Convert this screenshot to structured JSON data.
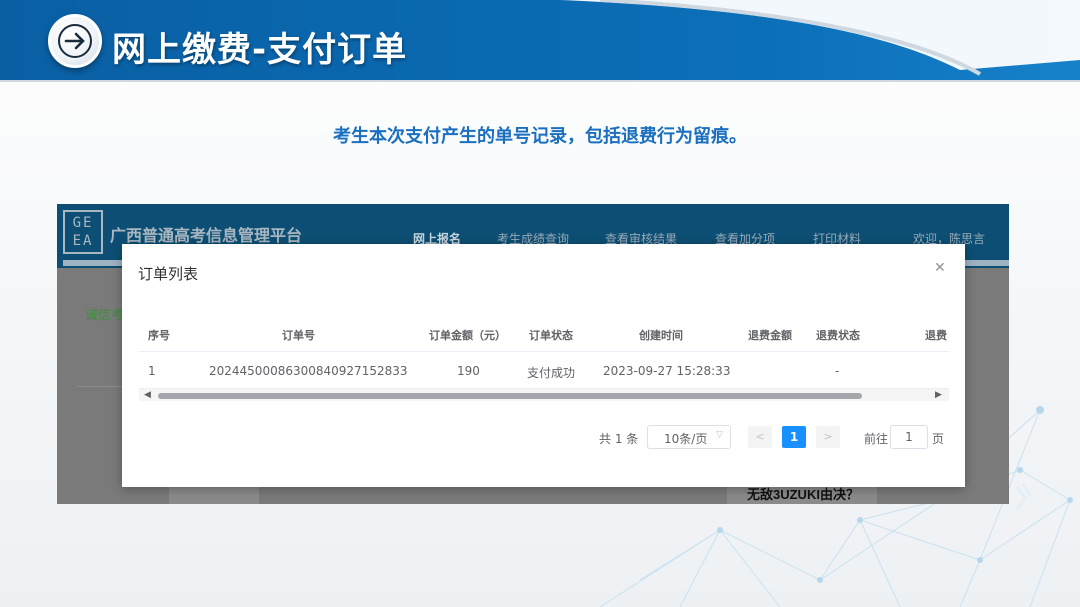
{
  "slide": {
    "title": "网上缴费-支付订单",
    "subtitle": "考生本次支付产生的单号记录，包括退费行为留痕。"
  },
  "app": {
    "logo_text": "GE EA",
    "name": "广西普通高考信息管理平台",
    "nav": [
      "网上报名",
      "考生成绩查询",
      "查看审核结果",
      "查看加分项",
      "打印材料"
    ],
    "welcome": "欢迎，陈思言",
    "left_text": "诚信考",
    "bottom_text": "无敌3UZUKI由决？"
  },
  "modal": {
    "title": "订单列表",
    "close_icon": "close-icon",
    "columns": [
      "序号",
      "订单号",
      "订单金额（元）",
      "订单状态",
      "创建时间",
      "退费金额",
      "退费状态",
      "退费"
    ],
    "rows": [
      {
        "index": "1",
        "order_no": "202445000863008409271528​33",
        "amount": "190",
        "status": "支付成功",
        "created": "2023-09-27 15:28:33",
        "refund_amount": "",
        "refund_status": "-"
      }
    ],
    "pager": {
      "total": "共 1 条",
      "page_size": "10条/页",
      "prev": "<",
      "current": "1",
      "next": ">",
      "goto_label": "前往",
      "goto_value": "1",
      "page_word": "页"
    }
  },
  "colors": {
    "header_blue": "#0b6fb8",
    "subtitle_blue": "#1a6fc0",
    "active_page": "#1890ff"
  }
}
